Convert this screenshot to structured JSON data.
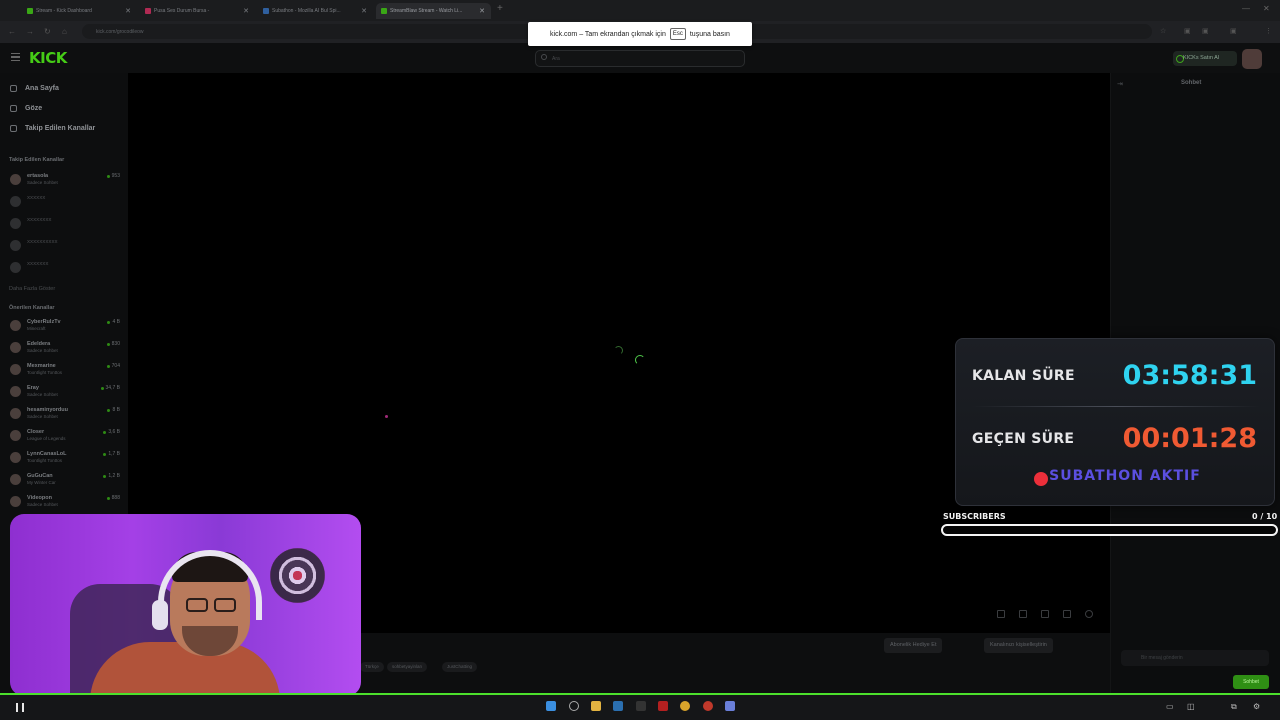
{
  "browser": {
    "tabs": [
      {
        "title": "Stream - Kick Dashboard",
        "color": "#53fc18",
        "active": false
      },
      {
        "title": "Pusa Ses Durum Bursa -",
        "color": "#e8356c",
        "active": false
      },
      {
        "title": "Subathon - Mozilla AI Bul Spi...",
        "color": "#3b82f6",
        "active": false
      },
      {
        "title": "StreamBlaw Stream - Watch Li...",
        "color": "#53fc18",
        "active": true
      }
    ],
    "url": "kick.com/grocodileow",
    "fullscreen_notice": {
      "prefix": "kick.com – Tam ekrandan çıkmak için",
      "key": "Esc",
      "suffix": "tuşuna basın"
    }
  },
  "kick": {
    "logo": "KICK",
    "search_placeholder": "Ara",
    "buy_button": "KICKs Satın Al",
    "nav": [
      {
        "label": "Ana Sayfa",
        "icon": "home-icon"
      },
      {
        "label": "Göze",
        "icon": "compass-icon"
      },
      {
        "label": "Takip Edilen Kanallar",
        "icon": "heart-icon"
      }
    ],
    "followed_title": "Takip Edilen Kanallar",
    "followed": [
      {
        "name": "ertasola",
        "category": "Sadece Sohbet",
        "viewers": "953",
        "online": true
      },
      {
        "name": "xxxxxx",
        "category": "",
        "viewers": "",
        "online": false
      },
      {
        "name": "xxxxxxxx",
        "category": "",
        "viewers": "",
        "online": false
      },
      {
        "name": "xxxxxxxxxx",
        "category": "",
        "viewers": "",
        "online": false
      },
      {
        "name": "xxxxxxx",
        "category": "",
        "viewers": "",
        "online": false
      }
    ],
    "show_more": "Daha Fazla Göster",
    "recommended_title": "Önerilen Kanallar",
    "recommended": [
      {
        "name": "CyberRulzTv",
        "category": "Minecraft",
        "viewers": "4 B"
      },
      {
        "name": "Edeldera",
        "category": "Sadece Sohbet",
        "viewers": "830"
      },
      {
        "name": "Mexmarine",
        "category": "Toontlight Tonttos",
        "viewers": "704"
      },
      {
        "name": "Eray",
        "category": "Sadece Sohbet",
        "viewers": "34,7 B"
      },
      {
        "name": "hesaminyorduu",
        "category": "Sadece Sohbet",
        "viewers": "8 B"
      },
      {
        "name": "Closer",
        "category": "League of Legends",
        "viewers": "3,6 B"
      },
      {
        "name": "LynnCanasLoL",
        "category": "Toontlight Tonttos",
        "viewers": "1,7 B"
      },
      {
        "name": "GuGuCan",
        "category": "My Winter Car",
        "viewers": "1,2 B"
      },
      {
        "name": "Videopon",
        "category": "Sadece Sohbet",
        "viewers": "888"
      }
    ],
    "below_buttons": {
      "gift": "Abonelik Hediye Et",
      "support": "Kanalınızı kişiselleştirin"
    },
    "tags": [
      "Türkçe",
      "sohbetyayinları",
      "JustChatting"
    ],
    "chat": {
      "title": "Sohbet",
      "input_placeholder": "Bir mesaj gönderin",
      "send_label": "Sohbet"
    }
  },
  "overlay": {
    "remaining_label": "KALAN SÜRE",
    "remaining_value": "03:58:31",
    "remaining_color": "#2fd3f0",
    "elapsed_label": "GEÇEN SÜRE",
    "elapsed_value": "00:01:28",
    "elapsed_color": "#f05a33",
    "status": "SUBATHON AKTIF",
    "status_color": "#5b4fe0",
    "subs_label": "SUBSCRIBERS",
    "subs_current": 0,
    "subs_goal": 10,
    "subs_text": "0 / 10"
  }
}
